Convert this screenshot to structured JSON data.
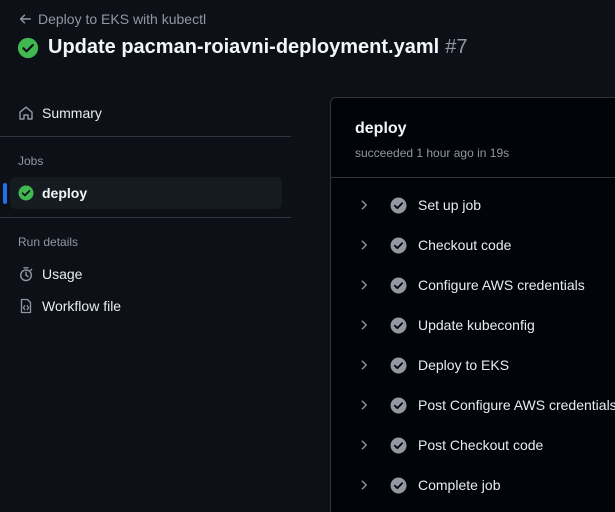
{
  "header": {
    "back_label": "Deploy to EKS with kubectl",
    "title": "Update pacman-roiavni-deployment.yaml",
    "run_number": "#7"
  },
  "sidebar": {
    "summary_label": "Summary",
    "jobs_heading": "Jobs",
    "job_label": "deploy",
    "run_details_heading": "Run details",
    "usage_label": "Usage",
    "workflow_label": "Workflow file"
  },
  "job": {
    "title": "deploy",
    "status": "succeeded 1 hour ago in 19s",
    "steps": [
      {
        "label": "Set up job"
      },
      {
        "label": "Checkout code"
      },
      {
        "label": "Configure AWS credentials"
      },
      {
        "label": "Update kubeconfig"
      },
      {
        "label": "Deploy to EKS"
      },
      {
        "label": "Post Configure AWS credentials"
      },
      {
        "label": "Post Checkout code"
      },
      {
        "label": "Complete job"
      }
    ]
  },
  "colors": {
    "success": "#3fb950",
    "step_check": "#9198a1",
    "accent": "#1f6feb"
  },
  "icons": {
    "back": "arrow-left-icon",
    "status": "check-circle-fill-icon",
    "summary": "home-icon",
    "usage": "stopwatch-icon",
    "workflow": "file-code-icon",
    "step_expand": "chevron-right-icon"
  }
}
